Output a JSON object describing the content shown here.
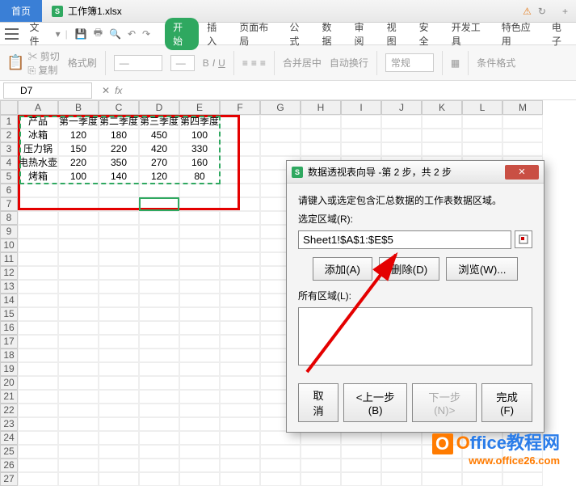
{
  "tabs": {
    "home": "首页",
    "file": "工作簿1.xlsx",
    "plus": "+"
  },
  "menubar": {
    "file": "文件",
    "items": [
      "开始",
      "插入",
      "页面布局",
      "公式",
      "数据",
      "审阅",
      "视图",
      "安全",
      "开发工具",
      "特色应用",
      "电子"
    ]
  },
  "toolbar": {
    "cut": "剪切",
    "copy": "复制",
    "paste": "粘贴",
    "fmtpaint": "格式刷",
    "normal": "常规",
    "acenter": "合并居中",
    "autowrap": "自动换行",
    "condfmt": "条件格式"
  },
  "namebox": "D7",
  "columns": [
    "A",
    "B",
    "C",
    "D",
    "E",
    "F",
    "G",
    "H",
    "I",
    "J",
    "K",
    "L",
    "M"
  ],
  "headers": [
    "产品",
    "第一季度",
    "第二季度",
    "第三季度",
    "第四季度"
  ],
  "tdata": [
    [
      "冰箱",
      "120",
      "180",
      "450",
      "100"
    ],
    [
      "压力锅",
      "150",
      "220",
      "420",
      "330"
    ],
    [
      "电热水壶",
      "220",
      "350",
      "270",
      "160"
    ],
    [
      "烤箱",
      "100",
      "140",
      "120",
      "80"
    ]
  ],
  "dialog": {
    "title": "数据透视表向导 -第 2 步，共 2 步",
    "instr": "请键入或选定包含汇总数据的工作表数据区域。",
    "range_lbl": "选定区域(R):",
    "range_val": "Sheet1!$A$1:$E$5",
    "add": "添加(A)",
    "delete": "删除(D)",
    "browse": "浏览(W)...",
    "all_lbl": "所有区域(L):",
    "cancel": "取消",
    "back": "<上一步(B)",
    "next": "下一步(N)>",
    "finish": "完成(F)"
  },
  "wm": {
    "brand1": "O",
    "brand2": "ffice",
    "brand3": "教程网",
    "url": "www.office26.com"
  }
}
